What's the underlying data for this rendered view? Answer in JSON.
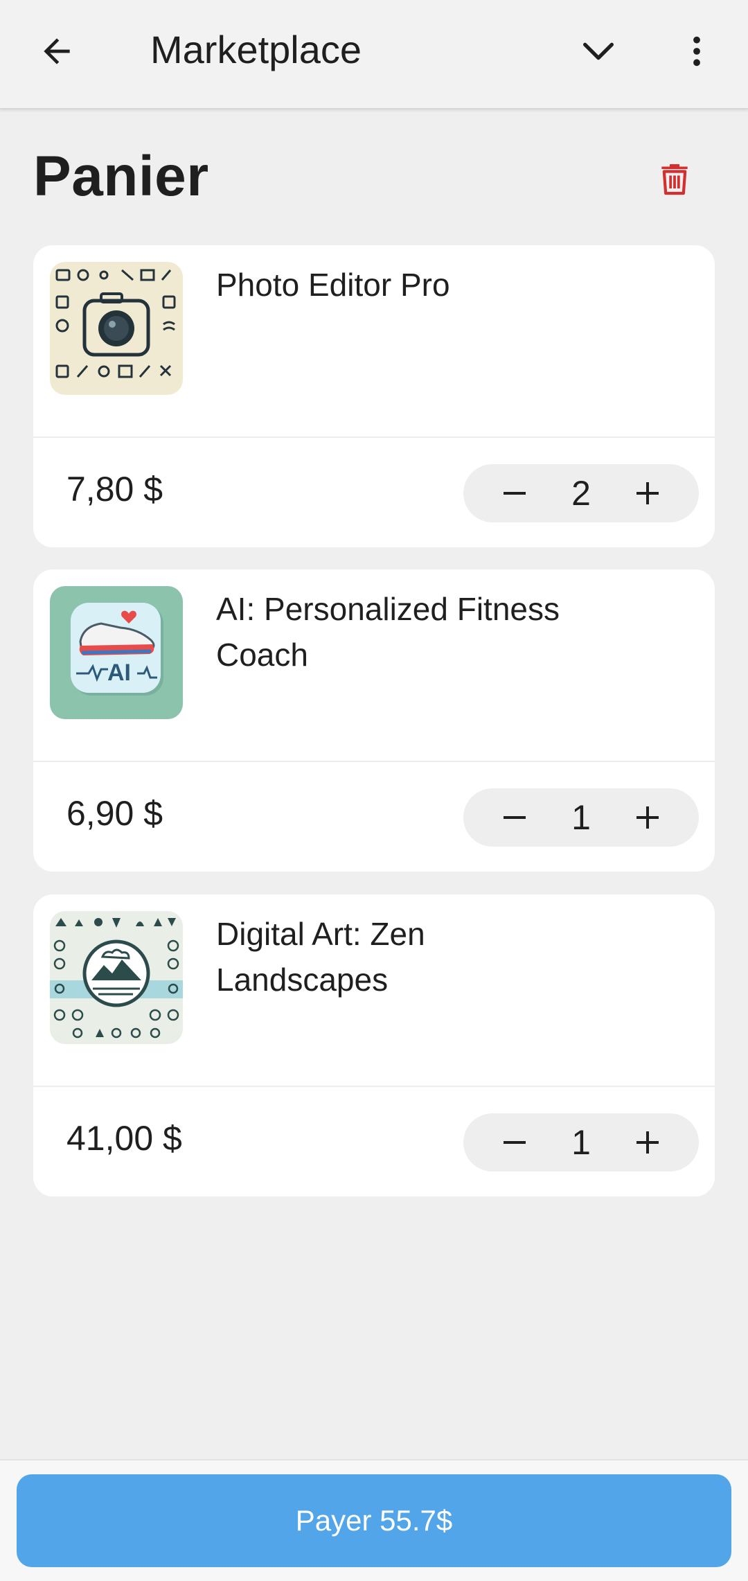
{
  "appbar": {
    "title": "Marketplace",
    "back_icon": "arrow-left-icon",
    "dropdown_icon": "chevron-down-icon",
    "more_icon": "more-vert-icon"
  },
  "cart": {
    "title": "Panier",
    "clear_icon": "trash-icon",
    "accent_danger": "#d32f2f"
  },
  "items": [
    {
      "name": "Photo Editor Pro",
      "price": "7,80 $",
      "quantity": "2",
      "thumb_icon": "camera-app-icon"
    },
    {
      "name": "AI: Personalized Fitness Coach",
      "price": "6,90 $",
      "quantity": "1",
      "thumb_icon": "fitness-sneaker-app-icon"
    },
    {
      "name": "Digital Art: Zen Landscapes",
      "price": "41,00 $",
      "quantity": "1",
      "thumb_icon": "zen-landscape-app-icon"
    }
  ],
  "stepper": {
    "minus_symbol": "−",
    "plus_symbol": "+"
  },
  "footer": {
    "pay_label": "Payer 55.7$",
    "pay_color": "#52a5e8"
  }
}
